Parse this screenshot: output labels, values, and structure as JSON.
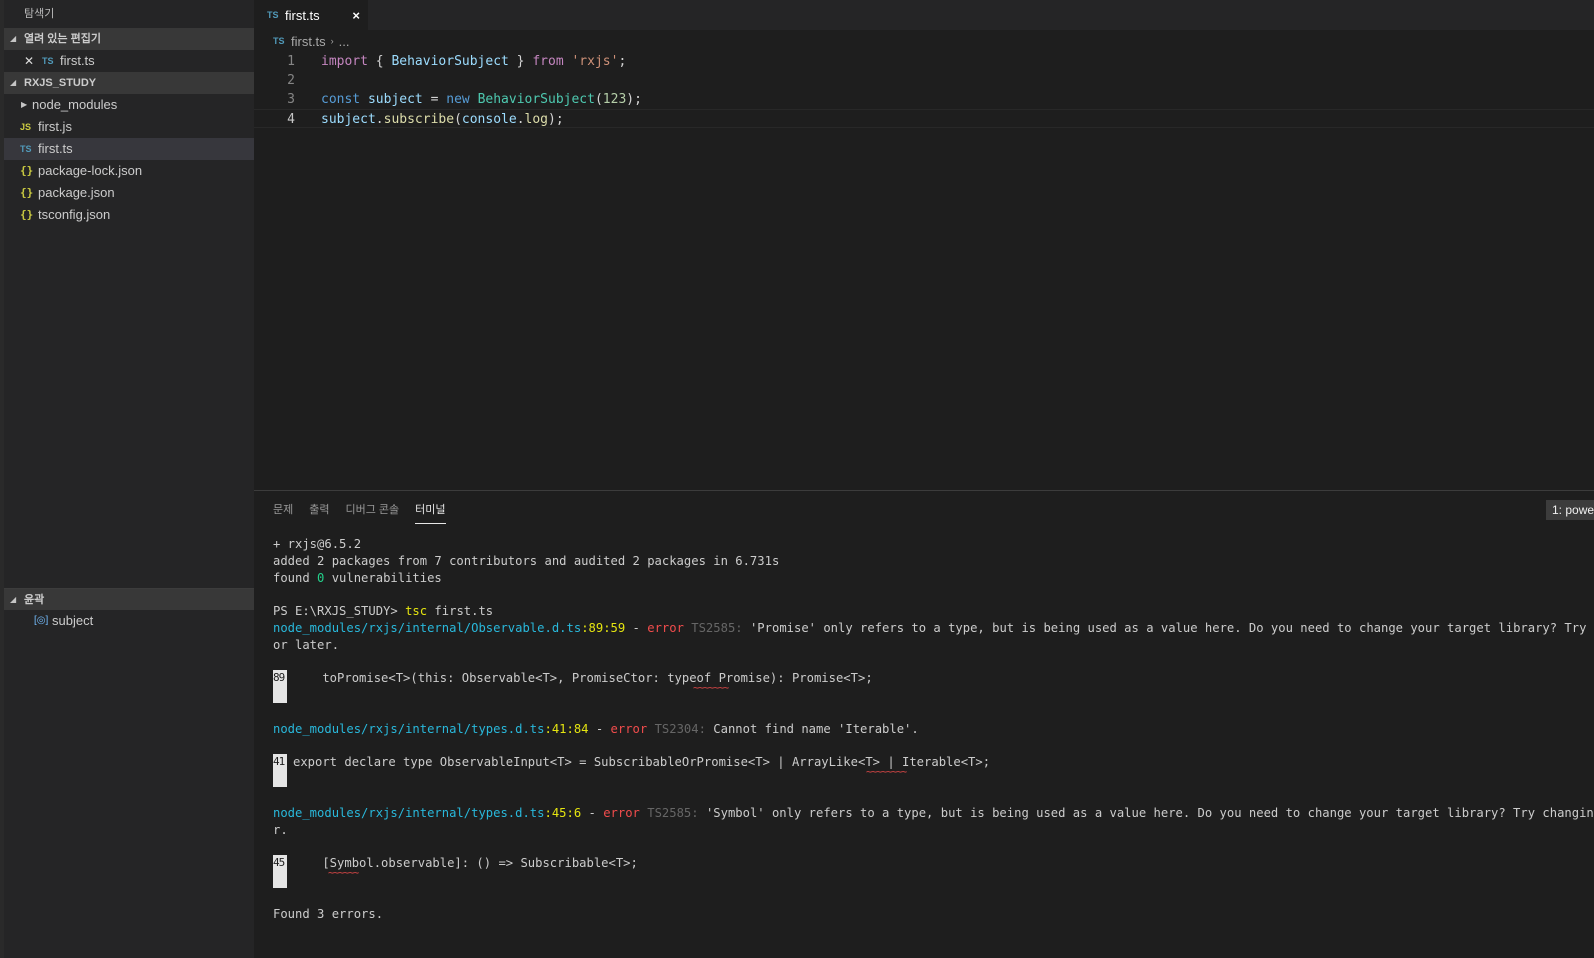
{
  "sidebar": {
    "title": "탐색기",
    "open_editors": {
      "header": "열려 있는 편집기",
      "items": [
        {
          "badge": "TS",
          "label": "first.ts"
        }
      ]
    },
    "project": {
      "header": "RXJS_STUDY",
      "items": [
        {
          "kind": "folder",
          "label": "node_modules"
        },
        {
          "kind": "js",
          "badge": "JS",
          "label": "first.js"
        },
        {
          "kind": "ts",
          "badge": "TS",
          "label": "first.ts",
          "selected": true
        },
        {
          "kind": "json",
          "badge": "{}",
          "label": "package-lock.json"
        },
        {
          "kind": "json",
          "badge": "{}",
          "label": "package.json"
        },
        {
          "kind": "json",
          "badge": "{}",
          "label": "tsconfig.json"
        }
      ]
    },
    "outline": {
      "header": "윤곽",
      "items": [
        {
          "symbol": "[◎]",
          "label": "subject"
        }
      ]
    }
  },
  "editor": {
    "tab": {
      "badge": "TS",
      "label": "first.ts",
      "close": "×"
    },
    "breadcrumb": {
      "badge": "TS",
      "file": "first.ts",
      "sep": "›",
      "more": "..."
    },
    "lines": [
      {
        "n": "1"
      },
      {
        "n": "2"
      },
      {
        "n": "3"
      },
      {
        "n": "4"
      }
    ],
    "tokens": {
      "l1_import": "import",
      "l1_brace_open": " { ",
      "l1_class": "BehaviorSubject",
      "l1_brace_close": " } ",
      "l1_from": "from",
      "l1_space": " ",
      "l1_string": "'rxjs'",
      "l1_semi": ";",
      "l3_const": "const",
      "l3_var": " subject",
      "l3_eq": " = ",
      "l3_new": "new",
      "l3_space": " ",
      "l3_class": "BehaviorSubject",
      "l3_paren_open": "(",
      "l3_num": "123",
      "l3_paren_close": ");",
      "l4_var": "subject",
      "l4_dot": ".",
      "l4_fn": "subscribe",
      "l4_paren_open": "(",
      "l4_console": "console",
      "l4_dot2": ".",
      "l4_log": "log",
      "l4_paren_close": ");"
    }
  },
  "panel": {
    "tabs": [
      "문제",
      "출력",
      "디버그 콘솔",
      "터미널"
    ],
    "active_tab": "터미널",
    "terminal_select": "1: powe",
    "terminal": {
      "l1": "+ rxjs@6.5.2",
      "l2": "added 2 packages from 7 contributors and audited 2 packages in 6.731s",
      "l3_a": "found ",
      "l3_num": "0",
      "l3_b": " vulnerabilities",
      "prompt": "PS E:\\RXJS_STUDY> ",
      "cmd": "tsc",
      "cmd_arg": " first.ts",
      "err1": {
        "path": "node_modules/rxjs/internal/Observable.d.ts",
        "pos": ":89:59",
        "dash": " - ",
        "level": "error",
        "code": " TS2585: ",
        "msg": "'Promise' only refers to a type, but is being used as a value here. Do you need to change your target library? Try changing",
        "cont": "or later.",
        "line_no": "89",
        "snippet": "    toPromise<T>(this: Observable<T>, PromiseCtor: typeof Promise): Promise<T>;",
        "squiggle": "~~~~~~~"
      },
      "err2": {
        "path": "node_modules/rxjs/internal/types.d.ts",
        "pos": ":41:84",
        "dash": " - ",
        "level": "error",
        "code": " TS2304: ",
        "msg": "Cannot find name 'Iterable'.",
        "line_no": "41",
        "snippet": "export declare type ObservableInput<T> = SubscribableOrPromise<T> | ArrayLike<T> | Iterable<T>;",
        "squiggle": "~~~~~~~~"
      },
      "err3": {
        "path": "node_modules/rxjs/internal/types.d.ts",
        "pos": ":45:6",
        "dash": " - ",
        "level": "error",
        "code": " TS2585: ",
        "msg": "'Symbol' only refers to a type, but is being used as a value here. Do you need to change your target library? Try changing the `l",
        "cont": "r.",
        "line_no": "45",
        "snippet": "    [Symbol.observable]: () => Subscribable<T>;",
        "squiggle": "~~~~~~"
      },
      "summary": "Found 3 errors."
    }
  }
}
